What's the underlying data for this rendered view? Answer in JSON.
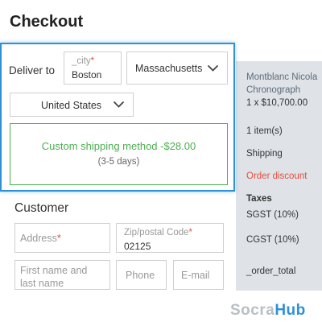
{
  "page": {
    "title": "Checkout"
  },
  "delivery": {
    "label": "Deliver to",
    "city": {
      "label": "_city",
      "required_mark": "*",
      "value": "Boston"
    },
    "state": {
      "value": "Massachusetts",
      "icon": "chevron-down-icon"
    },
    "country": {
      "value": "United States",
      "icon": "chevron-down-icon"
    },
    "shipping_option": {
      "title": "Custom shipping method -$28.00",
      "eta": "(3-5 days)",
      "color": "#4caf50"
    },
    "accent_color": "#2f90d8"
  },
  "customer": {
    "title": "Customer",
    "address": {
      "placeholder": "Address",
      "required_mark": "*"
    },
    "zip": {
      "label": "Zip/postal Code",
      "required_mark": "*",
      "value": "02125"
    },
    "first_last_name": {
      "placeholder": "First name and last name"
    },
    "phone": {
      "placeholder": "Phone"
    },
    "email": {
      "placeholder": "E-mail"
    }
  },
  "summary": {
    "product_name": "Montblanc Nicola Chronograph",
    "product_qty": "1 x $10,700.00",
    "items_count": "1 item(s)",
    "shipping_label": "Shipping",
    "discount_label": "Order discount",
    "discount_color": "#e74c3c",
    "taxes_title": "Taxes",
    "tax_lines": [
      "SGST (10%)",
      "CGST (10%)"
    ],
    "order_total_label": "_order_total"
  },
  "brand": {
    "part1": "Socra",
    "part2": "Hub"
  }
}
